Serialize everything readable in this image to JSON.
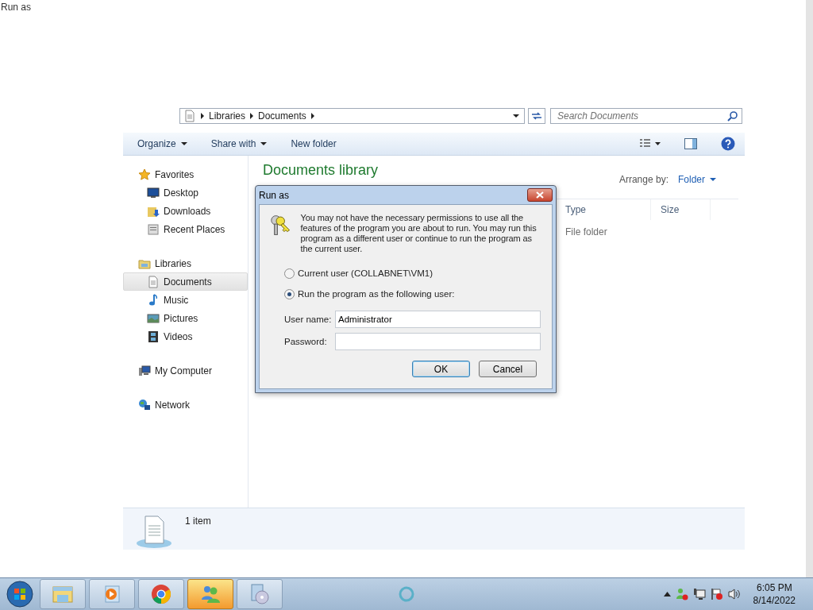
{
  "window": {
    "title": "Run as"
  },
  "explorer": {
    "breadcrumb": [
      "Libraries",
      "Documents"
    ],
    "search": {
      "placeholder": "Search Documents"
    },
    "toolbar": [
      {
        "label": "Organize",
        "dropdown": true
      },
      {
        "label": "Share with",
        "dropdown": true
      },
      {
        "label": "New folder",
        "dropdown": false
      }
    ],
    "sidebar": [
      {
        "label": "Favorites",
        "selected": false,
        "children": [
          {
            "label": "Desktop",
            "selected": false
          },
          {
            "label": "Downloads",
            "selected": false
          },
          {
            "label": "Recent Places",
            "selected": false
          }
        ]
      },
      {
        "label": "Libraries",
        "selected": false,
        "children": [
          {
            "label": "Documents",
            "selected": true
          },
          {
            "label": "Music",
            "selected": false
          },
          {
            "label": "Pictures",
            "selected": false
          },
          {
            "label": "Videos",
            "selected": false
          }
        ]
      },
      {
        "label": "My Computer",
        "selected": false
      },
      {
        "label": "Network",
        "selected": false
      }
    ],
    "library": {
      "title": "Documents library",
      "arrange_label": "Arrange by:",
      "arrange_value": "Folder"
    },
    "columns": [
      "Type",
      "Size"
    ],
    "rows": [
      {
        "type": "File folder"
      }
    ],
    "status": "1 item"
  },
  "dialog": {
    "title": "Run as",
    "message": "You may not have the necessary permissions to use all the features of the program you are about to run. You may run this program as a different user or continue to run the program as the current user.",
    "options": [
      {
        "label": "Current user (COLLABNET\\VM1)",
        "selected": false
      },
      {
        "label": "Run the program as the following user:",
        "selected": true
      }
    ],
    "fields": [
      {
        "label": "User name:",
        "value": "Administrator"
      },
      {
        "label": "Password:"
      }
    ],
    "buttons": [
      {
        "label": "OK",
        "default": true
      },
      {
        "label": "Cancel",
        "default": false
      }
    ]
  },
  "taskbar": {
    "apps": [
      {
        "active": false
      },
      {
        "active": false
      },
      {
        "active": false
      },
      {
        "active": true
      },
      {
        "active": false
      }
    ],
    "clock": {
      "time": "6:05 PM",
      "date": "8/14/2022"
    }
  }
}
